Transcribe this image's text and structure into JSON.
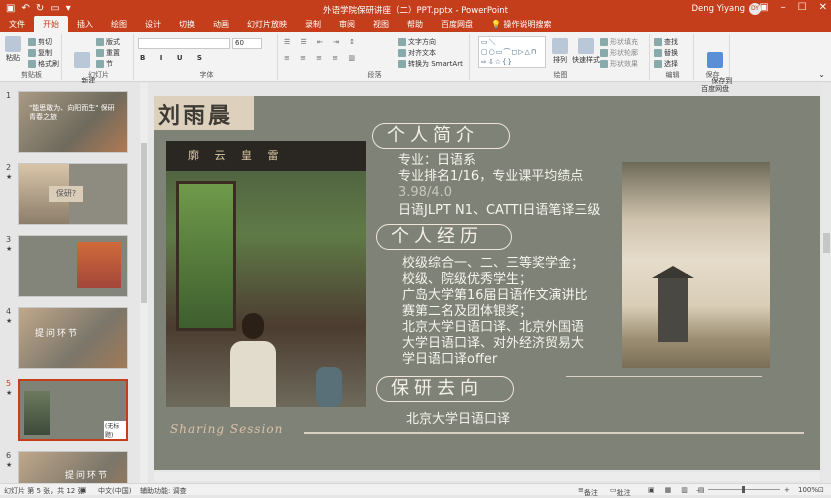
{
  "title_bar": {
    "document_title": "外语学院保研讲座（二）PPT.pptx  -  PowerPoint",
    "user_name": "Deng Yiyang",
    "user_initials": "DY"
  },
  "tabs": [
    "文件",
    "开始",
    "插入",
    "绘图",
    "设计",
    "切换",
    "动画",
    "幻灯片放映",
    "录制",
    "审阅",
    "视图",
    "帮助",
    "百度网盘",
    "操作说明搜索"
  ],
  "ribbon": {
    "clipboard": {
      "paste": "粘贴",
      "cut": "剪切",
      "copy": "复制",
      "format_painter": "格式刷",
      "label": "剪贴板"
    },
    "slides": {
      "new_slide": "新建\n幻灯片",
      "layout": "版式",
      "reset": "重置",
      "section": "节",
      "label": "幻灯片"
    },
    "font": {
      "font_size": "60",
      "label": "字体"
    },
    "paragraph": {
      "text_direction": "文字方向",
      "align_text": "对齐文本",
      "smartart": "转换为 SmartArt",
      "label": "段落"
    },
    "drawing": {
      "arrange": "排列",
      "quick_styles": "快速样式",
      "shape_fill": "形状填充",
      "shape_outline": "形状轮廓",
      "shape_effects": "形状效果",
      "label": "绘图"
    },
    "editing": {
      "find": "查找",
      "replace": "替换",
      "select": "选择",
      "label": "编辑"
    },
    "save": {
      "save_baidu": "保存到\n百度网盘",
      "label": "保存"
    }
  },
  "thumbnails": [
    {
      "num": "1",
      "star": "",
      "text": "\"能思敢为、向阳而生\" 保研青春之旅"
    },
    {
      "num": "2",
      "star": "★",
      "text": "保研?"
    },
    {
      "num": "3",
      "star": "★",
      "text": ""
    },
    {
      "num": "4",
      "star": "★",
      "text": "提问环节"
    },
    {
      "num": "5",
      "star": "★",
      "text": "(无标题)"
    },
    {
      "num": "6",
      "star": "★",
      "text": "提问环节"
    }
  ],
  "slide": {
    "name": "刘雨晨",
    "photo_sign": "廓 云 皇 雷",
    "section1_title": "个人简介",
    "section1_lines": [
      "专业：日语系",
      "专业排名1/16，专业课平均绩点",
      "3.98/4.0",
      "日语JLPT N1、CATTI日语笔译三级"
    ],
    "section2_title": "个人经历",
    "section2_lines": [
      "校级综合一、二、三等奖学金；",
      "校级、院级优秀学生；",
      "广岛大学第16届日语作文演讲比",
      "赛第二名及团体银奖；",
      "北京大学日语口译、北京外国语",
      "大学日语口译、对外经济贸易大",
      "学日语口译offer"
    ],
    "section3_title": "保研去向",
    "section3_line": "北京大学日语口译",
    "footer_script": "Sharing Session"
  },
  "status_bar": {
    "slide_info": "幻灯片 第 5 张，共 12 张",
    "language": "中文(中国)",
    "accessibility": "辅助功能: 调查",
    "notes": "备注",
    "comments": "批注",
    "zoom": "100%"
  },
  "colors": {
    "accent": "#c43e1c",
    "slide_bg": "#7f8277",
    "pill_border": "#ece5d8"
  }
}
